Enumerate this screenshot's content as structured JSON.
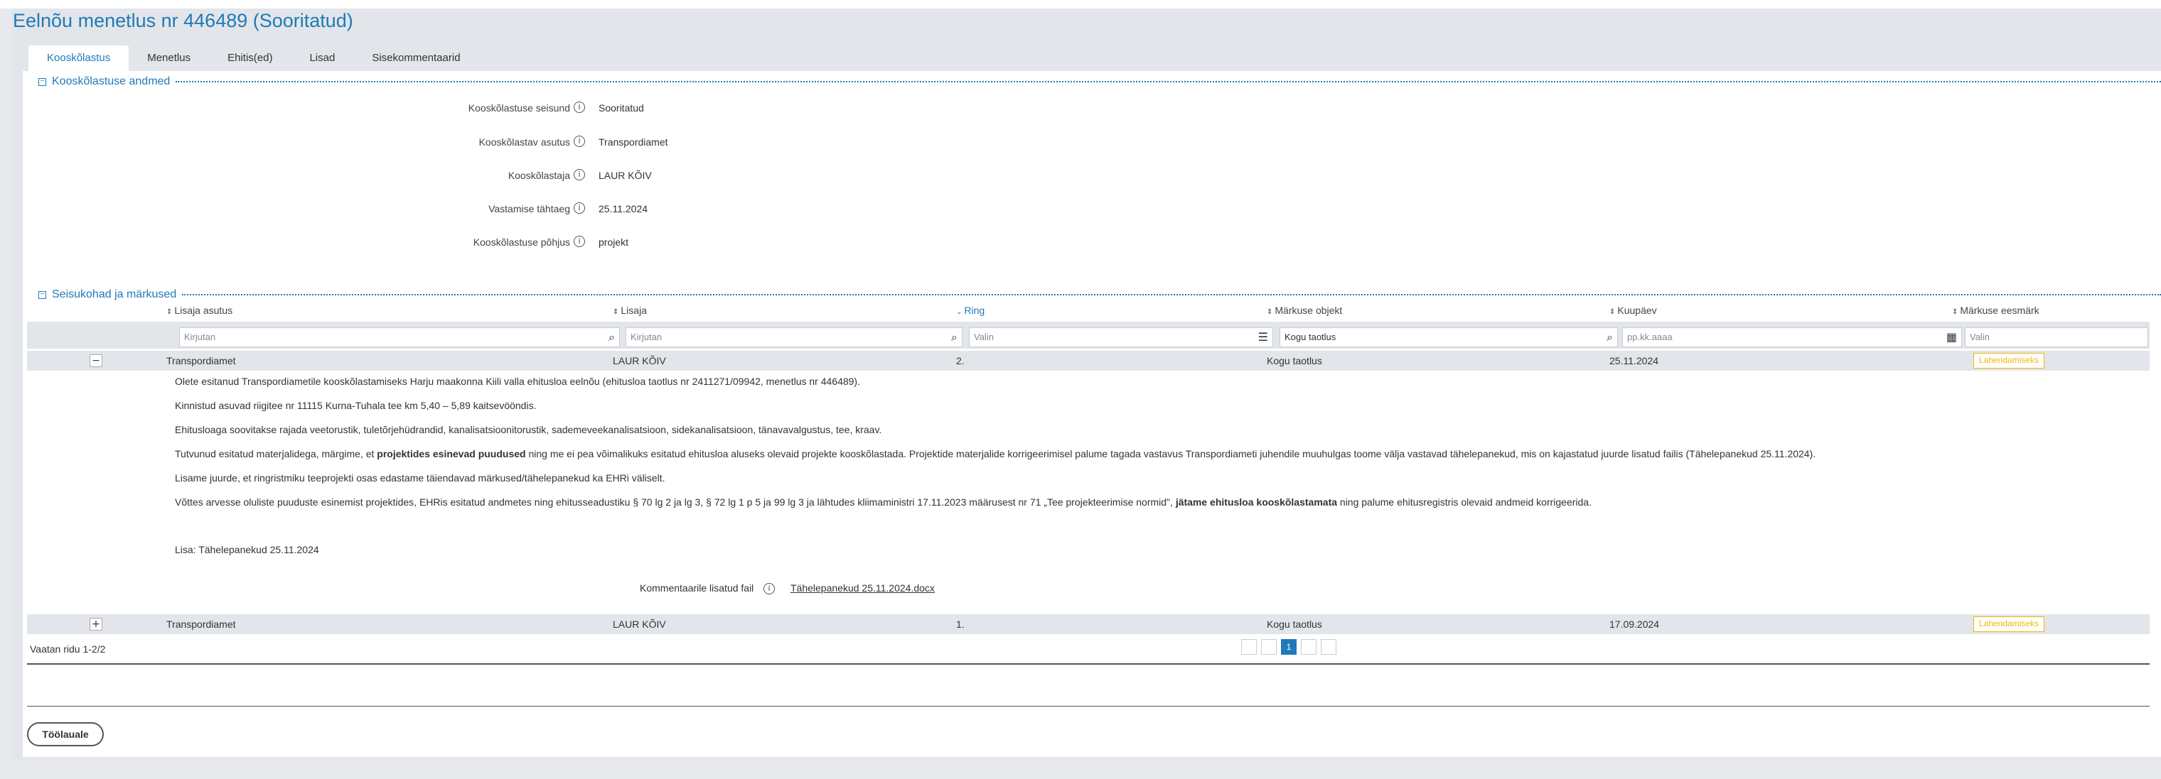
{
  "page_title": "Eelnõu menetlus nr 446489 (Sooritatud)",
  "tabs": [
    {
      "label": "Kooskõlastus"
    },
    {
      "label": "Menetlus"
    },
    {
      "label": "Ehitis(ed)"
    },
    {
      "label": "Lisad"
    },
    {
      "label": "Sisekommentaarid"
    }
  ],
  "section1": {
    "title": "Kooskõlastuse andmed",
    "fields": [
      {
        "label": "Kooskõlastuse seisund",
        "value": "Sooritatud"
      },
      {
        "label": "Kooskõlastav asutus",
        "value": "Transpordiamet"
      },
      {
        "label": "Kooskõlastaja",
        "value": "LAUR KÕIV"
      },
      {
        "label": "Vastamise tähtaeg",
        "value": "25.11.2024"
      },
      {
        "label": "Kooskõlastuse põhjus",
        "value": "projekt"
      }
    ]
  },
  "section2": {
    "title": "Seisukohad ja märkused",
    "columns": [
      {
        "label": "Lisaja asutus"
      },
      {
        "label": "Lisaja"
      },
      {
        "label": "Ring"
      },
      {
        "label": "Märkuse objekt"
      },
      {
        "label": "Kuupäev"
      },
      {
        "label": "Märkuse eesmärk"
      }
    ],
    "filters": [
      {
        "placeholder": "Kirjutan"
      },
      {
        "placeholder": "Kirjutan"
      },
      {
        "placeholder": "Valin"
      },
      {
        "value": "Kogu taotlus"
      },
      {
        "placeholder": "pp.kk.aaaa"
      },
      {
        "placeholder": "Valin"
      }
    ],
    "rows": [
      {
        "toggle": "−",
        "asutus": "Transpordiamet",
        "lisaja": "LAUR KÕIV",
        "ring": "2.",
        "objekt": "Kogu taotlus",
        "kuupaev": "25.11.2024",
        "eesmark": "Lahendamiseks"
      },
      {
        "toggle": "+",
        "asutus": "Transpordiamet",
        "lisaja": "LAUR KÕIV",
        "ring": "1.",
        "objekt": "Kogu taotlus",
        "kuupaev": "17.09.2024",
        "eesmark": "Lahendamiseks"
      }
    ],
    "detail": {
      "p1": "Olete esitanud Transpordiametile kooskõlastamiseks Harju maakonna Kiili valla ehitusloa eelnõu (ehitusloa taotlus nr 2411271/09942, menetlus nr 446489).",
      "p2": "Kinnistud asuvad riigitee nr 11115 Kurna-Tuhala tee km 5,40 – 5,89 kaitsevööndis.",
      "p3": "Ehitusloaga soovitakse rajada veetorustik, tuletõrjehüdrandid, kanalisatsioonitorustik, sademeveekanalisatsioon, sidekanalisatsioon, tänavavalgustus, tee, kraav.",
      "p4_a": "Tutvunud esitatud materjalidega, märgime, et ",
      "p4_b": "projektides esinevad puudused",
      "p4_c": " ning me ei pea võimalikuks esitatud ehitusloa aluseks olevaid projekte kooskõlastada. Projektide materjalide korrigeerimisel palume tagada vastavus Transpordiameti juhendile muuhulgas toome välja vastavad tähelepanekud, mis on kajastatud juurde lisatud failis (Tähelepanekud 25.11.2024).",
      "p5": "Lisame juurde, et ringristmiku teeprojekti osas edastame täiendavad märkused/tähelepanekud ka EHRi väliselt.",
      "p6_a": "Võttes arvesse oluliste puuduste esinemist projektides, EHRis esitatud andmetes ning ehitusseadustiku § 70 lg 2 ja lg 3, § 72 lg 1 p 5 ja 99 lg 3 ja lähtudes kliimaministri 17.11.2023 määrusest nr 71 „Tee projekteerimise normid\", ",
      "p6_b": "jätame ehitusloa kooskõlastamata",
      "p6_c": " ning palume ehitusregistris olevaid andmeid korrigeerida.",
      "lisa": "Lisa: Tähelepanekud 25.11.2024",
      "attach_label": "Kommentaarile lisatud fail",
      "attach_file": "Tähelepanekud 25.11.2024.docx"
    },
    "footer_text": "Vaatan ridu 1-2/2",
    "pager_current": "1"
  },
  "back_button": "Töölauale",
  "icons": {
    "info": "info-icon",
    "search": "search-icon",
    "list": "list-icon",
    "calendar": "calendar-icon",
    "sort": "sort-icon"
  },
  "colors": {
    "accent": "#1f7ab8",
    "badge": "#f0b800"
  }
}
